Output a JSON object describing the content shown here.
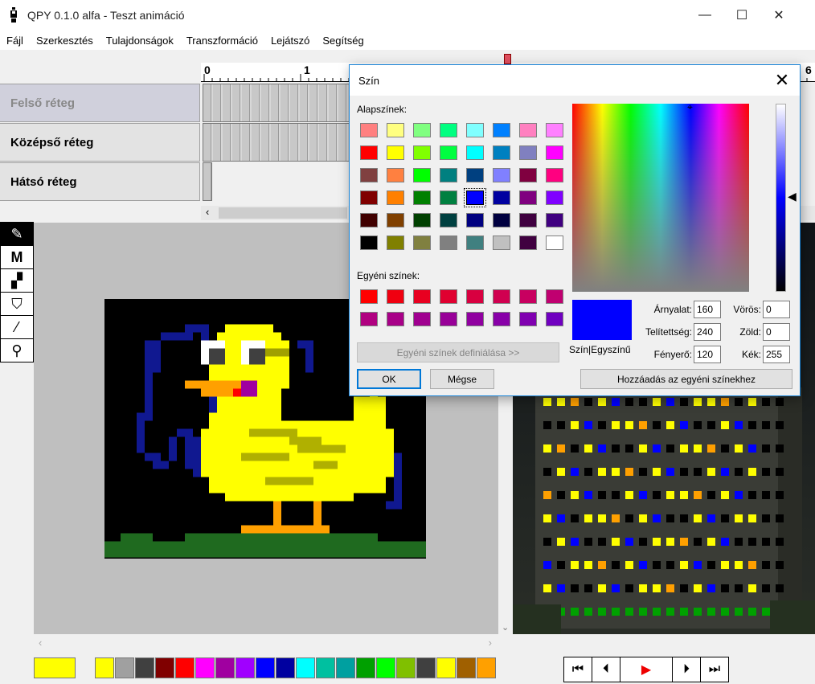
{
  "window": {
    "title": "QPY 0.1.0 alfa - Teszt animáció",
    "minimize": "—",
    "maximize": "☐",
    "close": "✕"
  },
  "menu": [
    "Fájl",
    "Szerkesztés",
    "Tulajdonságok",
    "Transzformáció",
    "Lejátszó",
    "Segítség"
  ],
  "layers": [
    {
      "label": "Felső réteg",
      "active": true
    },
    {
      "label": "Középső réteg",
      "active": false
    },
    {
      "label": "Hátsó réteg",
      "active": false
    }
  ],
  "ruler": {
    "labels": [
      "0",
      "1",
      "6"
    ]
  },
  "tools": [
    "pencil-icon",
    "line-icon",
    "rectangle-icon",
    "fill-bucket-icon",
    "eyedropper-icon",
    "zoom-icon"
  ],
  "palette": {
    "current": "#ffff00",
    "colors": [
      "#ffff00",
      "#a0a0a0",
      "#404040",
      "#800000",
      "#ff0000",
      "#ff00ff",
      "#a000a0",
      "#a000ff",
      "#0000ff",
      "#0000a0",
      "#00ffff",
      "#00c0a0",
      "#00a0a0",
      "#00a000",
      "#00ff00",
      "#80c000",
      "#404040",
      "#ffff00",
      "#a06000",
      "#ffa000"
    ]
  },
  "player": {
    "first": "⏮",
    "prev": "⏴",
    "play": "▶",
    "next": "⏵",
    "last": "⏭"
  },
  "dialog": {
    "title": "Szín",
    "basic_colors_label": "Alapszínek:",
    "custom_colors_label": "Egyéni színek:",
    "define_custom_button": "Egyéni színek definiálása >>",
    "ok_button": "OK",
    "cancel_button": "Mégse",
    "add_custom_button": "Hozzáadás az egyéni színekhez",
    "preview_label": "Szín|Egyszínű",
    "fields": {
      "hue_label": "Árnyalat:",
      "hue": "160",
      "sat_label": "Telítettség:",
      "sat": "240",
      "lum_label": "Fényerő:",
      "lum": "120",
      "red_label": "Vörös:",
      "red": "0",
      "green_label": "Zöld:",
      "green": "0",
      "blue_label": "Kék:",
      "blue": "255"
    },
    "selected_color": "#0000ff",
    "basic_colors": [
      [
        "#ff8080",
        "#ffff80",
        "#80ff80",
        "#00ff80",
        "#80ffff",
        "#0080ff",
        "#ff80c0",
        "#ff80ff"
      ],
      [
        "#ff0000",
        "#ffff00",
        "#80ff00",
        "#00ff40",
        "#00ffff",
        "#0080c0",
        "#8080c0",
        "#ff00ff"
      ],
      [
        "#804040",
        "#ff8040",
        "#00ff00",
        "#008080",
        "#004080",
        "#8080ff",
        "#800040",
        "#ff0080"
      ],
      [
        "#800000",
        "#ff8000",
        "#008000",
        "#008040",
        "#0000ff",
        "#0000a0",
        "#800080",
        "#8000ff"
      ],
      [
        "#400000",
        "#804000",
        "#004000",
        "#004040",
        "#000080",
        "#000040",
        "#400040",
        "#400080"
      ],
      [
        "#000000",
        "#808000",
        "#808040",
        "#808080",
        "#408080",
        "#c0c0c0",
        "#400040",
        "#ffffff"
      ]
    ],
    "custom_colors": [
      [
        "#ff0000",
        "#f00010",
        "#e80020",
        "#e00030",
        "#d80040",
        "#d00050",
        "#c80060",
        "#c00070"
      ],
      [
        "#b00080",
        "#a80088",
        "#a00090",
        "#980098",
        "#9000a0",
        "#8800a8",
        "#8000b0",
        "#7000c0"
      ]
    ]
  }
}
